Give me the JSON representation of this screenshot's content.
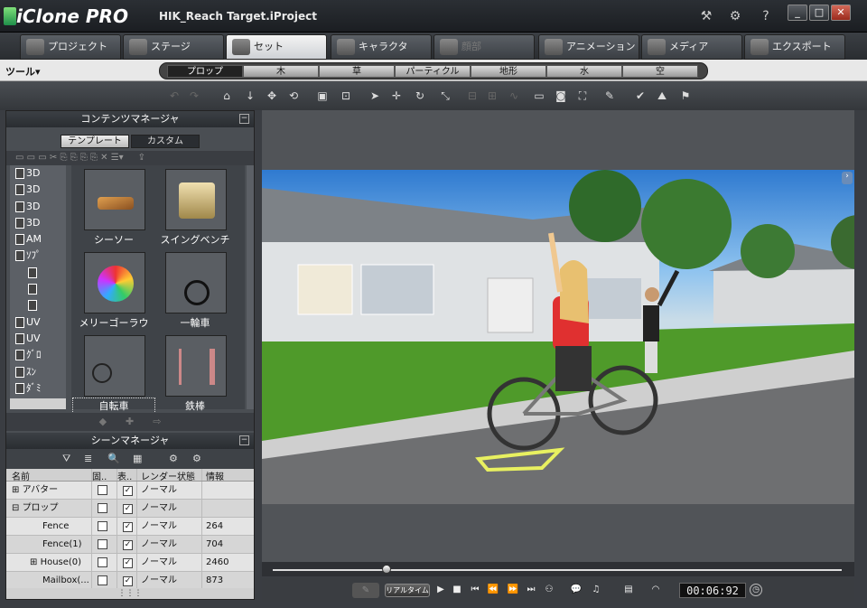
{
  "app": {
    "name": "iClone PRO",
    "project": "HIK_Reach Target.iProject"
  },
  "title_icons": [
    "help-tools-icon",
    "settings-icon",
    "help-icon"
  ],
  "window_buttons": [
    "_",
    "□",
    "✕"
  ],
  "tabs": [
    {
      "label": "プロジェクト",
      "state": "normal"
    },
    {
      "label": "ステージ",
      "state": "normal"
    },
    {
      "label": "セット",
      "state": "active"
    },
    {
      "label": "キャラクタ",
      "state": "normal"
    },
    {
      "label": "顔部",
      "state": "disabled"
    },
    {
      "label": "アニメーション",
      "state": "normal"
    },
    {
      "label": "メディア",
      "state": "normal"
    },
    {
      "label": "エクスポート",
      "state": "normal"
    }
  ],
  "tools_label": "ツール▾",
  "set_categories": [
    "プロップ",
    "木",
    "草",
    "パーティクル",
    "地形",
    "水",
    "空"
  ],
  "content_manager": {
    "title": "コンテンツマネージャ",
    "subtabs": [
      "テンプレート",
      "カスタム"
    ],
    "tree": [
      "3D",
      "3D",
      "3D",
      "3D",
      "AM",
      "ｿﾌﾟ",
      "",
      "",
      "",
      "UV",
      "UV",
      "ｸﾞﾛ",
      "ｽﾝ",
      "ﾀﾞﾐ"
    ],
    "items": [
      {
        "label": "シーソー"
      },
      {
        "label": "スイングベンチ"
      },
      {
        "label": "メリーゴーラウ"
      },
      {
        "label": "一輪車"
      },
      {
        "label": "自転車"
      },
      {
        "label": "鉄棒"
      }
    ]
  },
  "scene_manager": {
    "title": "シーンマネージャ",
    "columns": [
      "名前",
      "固..",
      "表..",
      "レンダー状態",
      "情報"
    ],
    "rows": [
      {
        "name": "アバター",
        "visible": "✓",
        "render": "ノーマル",
        "info": ""
      },
      {
        "name": "プロップ",
        "visible": "✓",
        "render": "ノーマル",
        "info": ""
      },
      {
        "name": "Fence",
        "visible": "✓",
        "render": "ノーマル",
        "info": "264"
      },
      {
        "name": "Fence(1)",
        "visible": "✓",
        "render": "ノーマル",
        "info": "704"
      },
      {
        "name": "House(0)",
        "visible": "✓",
        "render": "ノーマル",
        "info": "2460"
      },
      {
        "name": "Mailbox(...",
        "visible": "✓",
        "render": "ノーマル",
        "info": "873"
      }
    ]
  },
  "playback": {
    "realtime_label": "リアルタイム",
    "timecode": "00:06:92",
    "progress": 0.2
  },
  "colors": {
    "accent": "#2fb24a",
    "tab_active": "#e6e8ea",
    "panel": "#4a4e53"
  }
}
